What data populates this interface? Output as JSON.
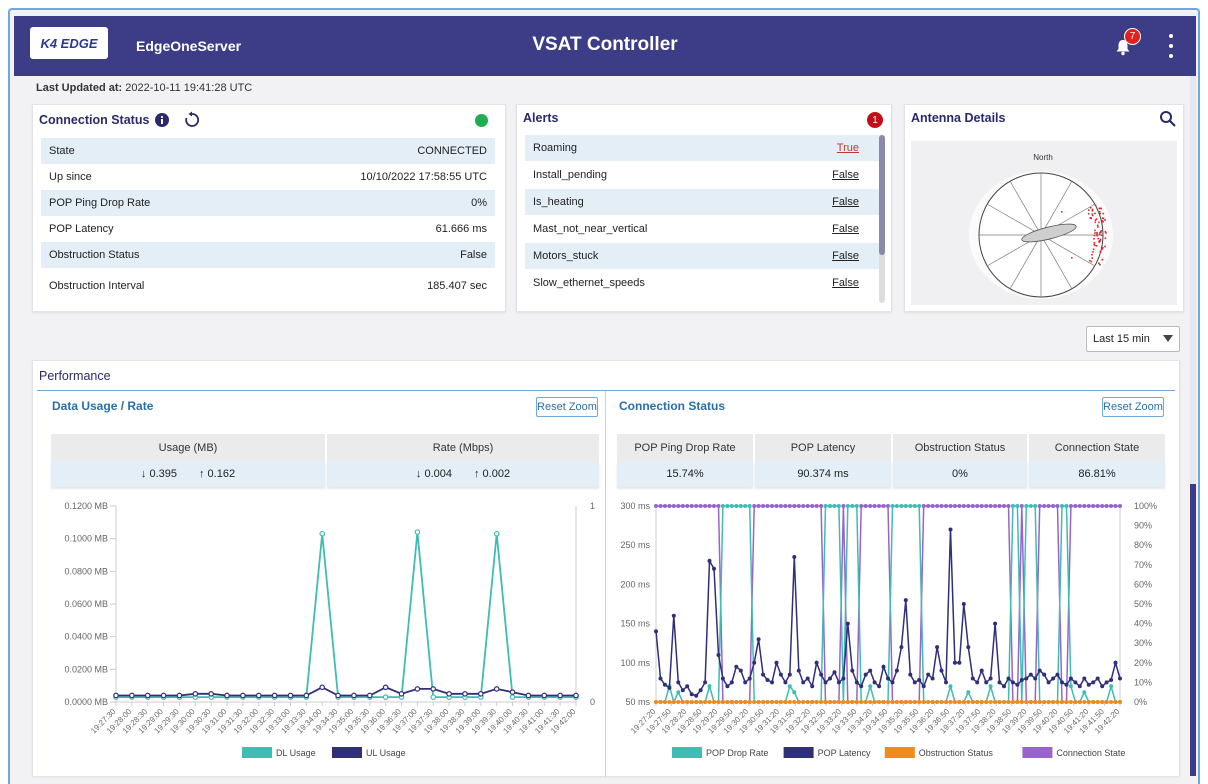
{
  "header": {
    "logo_text": "K4 EDGE",
    "server_name": "EdgeOneServer",
    "title": "VSAT Controller",
    "notification_count": "7"
  },
  "last_updated": {
    "label": "Last Updated at:",
    "value": "2022-10-11 19:41:28 UTC"
  },
  "connection_status": {
    "title": "Connection Status",
    "status_color": "#1fae4f",
    "rows": [
      {
        "label": "State",
        "value": "CONNECTED"
      },
      {
        "label": "Up since",
        "value": "10/10/2022 17:58:55 UTC"
      },
      {
        "label": "POP Ping Drop Rate",
        "value": "0%"
      },
      {
        "label": "POP Latency",
        "value": "61.666 ms"
      },
      {
        "label": "Obstruction Status",
        "value": "False"
      },
      {
        "label": "Obstruction Interval",
        "value": "185.407 sec"
      }
    ]
  },
  "alerts": {
    "title": "Alerts",
    "count": "1",
    "rows": [
      {
        "label": "Roaming",
        "value": "True"
      },
      {
        "label": "Install_pending",
        "value": "False"
      },
      {
        "label": "Is_heating",
        "value": "False"
      },
      {
        "label": "Mast_not_near_vertical",
        "value": "False"
      },
      {
        "label": "Motors_stuck",
        "value": "False"
      },
      {
        "label": "Slow_ethernet_speeds",
        "value": "False"
      }
    ]
  },
  "antenna": {
    "title": "Antenna Details",
    "north_label": "North"
  },
  "time_range": {
    "selected": "Last 15 min"
  },
  "performance": {
    "title": "Performance"
  },
  "data_usage": {
    "title": "Data Usage / Rate",
    "reset_label": "Reset Zoom",
    "usage_header": "Usage (MB)",
    "rate_header": "Rate (Mbps)",
    "usage_dl": "↓ 0.395",
    "usage_ul": "↑ 0.162",
    "rate_dl": "↓ 0.004",
    "rate_ul": "↑ 0.002"
  },
  "conn_chart": {
    "title": "Connection Status",
    "reset_label": "Reset Zoom",
    "stats": [
      {
        "label": "POP Ping Drop Rate",
        "value": "15.74%"
      },
      {
        "label": "POP Latency",
        "value": "90.374 ms"
      },
      {
        "label": "Obstruction Status",
        "value": "0%"
      },
      {
        "label": "Connection State",
        "value": "86.81%"
      }
    ]
  },
  "chart_data": [
    {
      "type": "line",
      "x": [
        "19:27:30",
        "19:28:00",
        "19:28:30",
        "19:29:00",
        "19:29:30",
        "19:30:00",
        "19:30:30",
        "19:31:00",
        "19:31:30",
        "19:32:00",
        "19:32:30",
        "19:33:00",
        "19:33:30",
        "19:34:00",
        "19:34:30",
        "19:35:00",
        "19:35:30",
        "19:36:00",
        "19:36:30",
        "19:37:00",
        "19:37:30",
        "19:38:00",
        "19:38:30",
        "19:39:00",
        "19:39:30",
        "19:40:00",
        "19:40:30",
        "19:41:00",
        "19:41:30",
        "19:42:00"
      ],
      "y_left_ticks": [
        "0.0000 MB",
        "0.0200 MB",
        "0.0400 MB",
        "0.0600 MB",
        "0.0800 MB",
        "0.1000 MB",
        "0.1200 MB"
      ],
      "y_right_ticks": [
        "0",
        "1"
      ],
      "ylim": [
        0,
        0.12
      ],
      "series": [
        {
          "name": "DL Usage",
          "color": "#3dbdb3",
          "values": [
            0.003,
            0.003,
            0.003,
            0.003,
            0.003,
            0.003,
            0.003,
            0.003,
            0.003,
            0.003,
            0.003,
            0.003,
            0.003,
            0.103,
            0.003,
            0.003,
            0.003,
            0.003,
            0.003,
            0.104,
            0.003,
            0.003,
            0.003,
            0.003,
            0.103,
            0.003,
            0.003,
            0.003,
            0.003,
            0.003
          ]
        },
        {
          "name": "UL Usage",
          "color": "#2f2f7a",
          "values": [
            0.004,
            0.004,
            0.004,
            0.004,
            0.004,
            0.005,
            0.005,
            0.004,
            0.004,
            0.004,
            0.004,
            0.004,
            0.004,
            0.009,
            0.004,
            0.004,
            0.004,
            0.009,
            0.005,
            0.008,
            0.008,
            0.005,
            0.005,
            0.005,
            0.008,
            0.006,
            0.004,
            0.004,
            0.004,
            0.004
          ]
        }
      ]
    },
    {
      "type": "line",
      "x": [
        "19:27:20",
        "19:27:50",
        "19:28:20",
        "19:28:50",
        "19:29:20",
        "19:29:50",
        "19:30:20",
        "19:30:50",
        "19:31:20",
        "19:31:50",
        "19:32:20",
        "19:32:50",
        "19:33:20",
        "19:33:50",
        "19:34:20",
        "19:34:50",
        "19:35:20",
        "19:35:50",
        "19:36:20",
        "19:36:50",
        "19:37:20",
        "19:37:50",
        "19:38:20",
        "19:38:50",
        "19:39:20",
        "19:39:50",
        "19:40:20",
        "19:40:50",
        "19:41:20",
        "19:41:50",
        "19:42:20"
      ],
      "y_left_ticks": [
        "50 ms",
        "100 ms",
        "150 ms",
        "200 ms",
        "250 ms",
        "300 ms"
      ],
      "y_right_ticks": [
        "0%",
        "10%",
        "20%",
        "30%",
        "40%",
        "50%",
        "60%",
        "70%",
        "80%",
        "90%",
        "100%"
      ],
      "ylim_left": [
        50,
        300
      ],
      "ylim_right": [
        0,
        100
      ],
      "series": [
        {
          "name": "POP Drop Rate",
          "color": "#3dbdb3"
        },
        {
          "name": "POP Latency",
          "color": "#2f2f7a",
          "values": [
            140,
            80,
            72,
            68,
            160,
            75,
            65,
            70,
            60,
            58,
            65,
            75,
            230,
            220,
            110,
            80,
            70,
            75,
            95,
            90,
            75,
            80,
            100,
            130,
            85,
            78,
            75,
            100,
            85,
            75,
            85,
            235,
            90,
            75,
            80,
            70,
            100,
            85,
            75,
            80,
            88,
            75,
            80,
            150,
            90,
            75,
            70,
            85,
            90,
            75,
            70,
            95,
            80,
            75,
            90,
            120,
            180,
            85,
            75,
            78,
            70,
            85,
            80,
            120,
            90,
            75,
            270,
            100,
            100,
            175,
            120,
            80,
            75,
            90,
            75,
            80,
            150,
            75,
            70,
            80,
            75,
            72,
            78,
            80,
            85,
            80,
            90,
            85,
            75,
            80,
            85,
            75,
            72,
            80,
            75,
            70,
            80,
            72,
            75,
            80,
            70,
            75,
            78,
            100,
            80
          ]
        },
        {
          "name": "Obstruction Status",
          "color": "#f08c1e"
        },
        {
          "name": "Connection State",
          "color": "#9a63cc"
        }
      ]
    }
  ]
}
